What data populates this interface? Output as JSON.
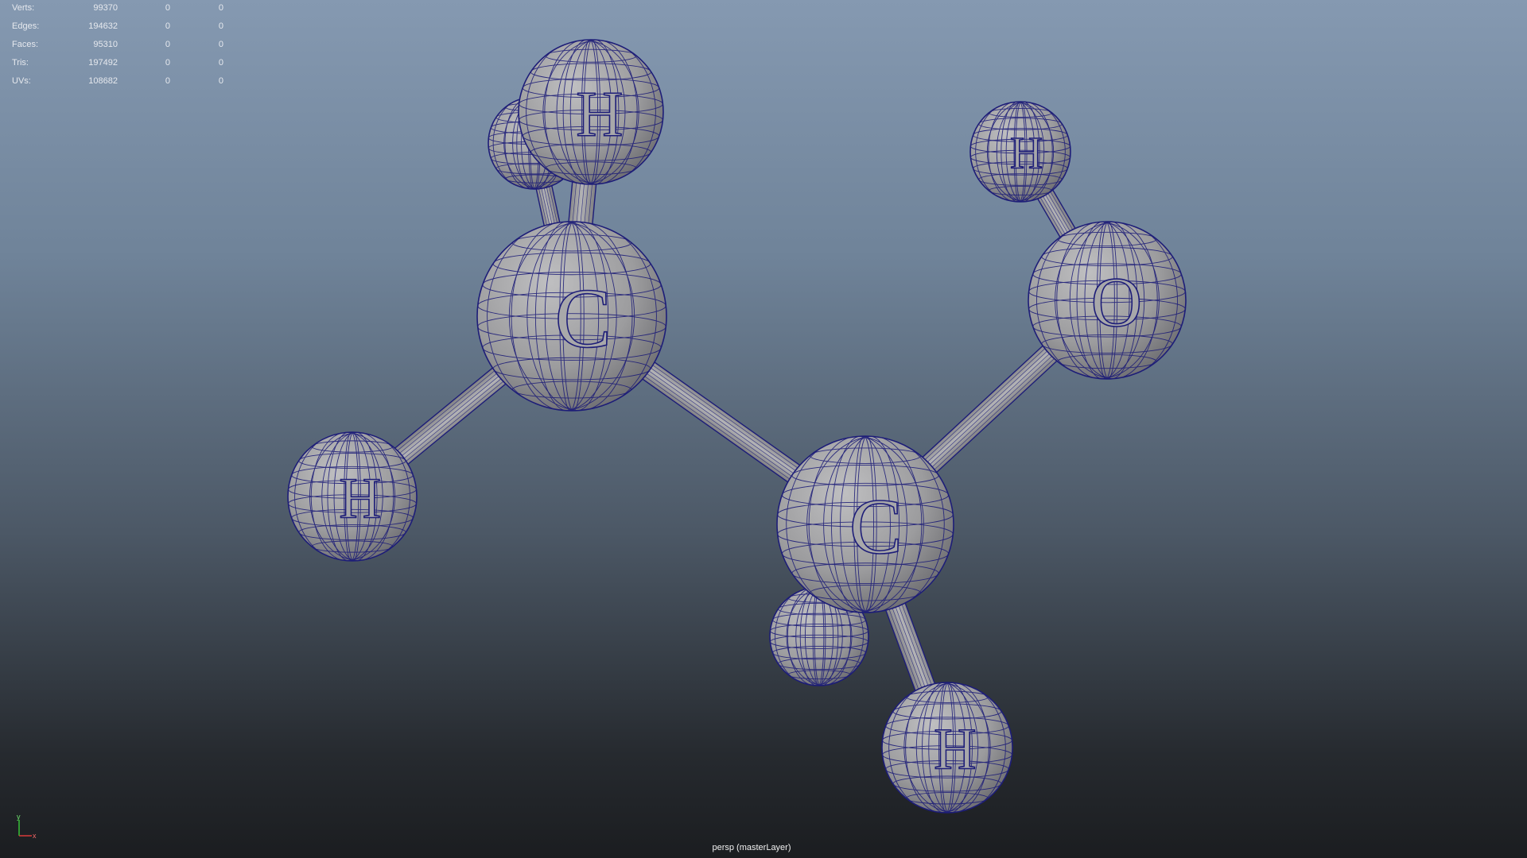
{
  "stats": [
    {
      "label": "Verts:",
      "values": [
        "99370",
        "0",
        "0"
      ]
    },
    {
      "label": "Edges:",
      "values": [
        "194632",
        "0",
        "0"
      ]
    },
    {
      "label": "Faces:",
      "values": [
        "95310",
        "0",
        "0"
      ]
    },
    {
      "label": "Tris:",
      "values": [
        "197492",
        "0",
        "0"
      ]
    },
    {
      "label": "UVs:",
      "values": [
        "108682",
        "0",
        "0"
      ]
    }
  ],
  "atoms": {
    "h_top_back": "",
    "h_top": "H",
    "c_left": "C",
    "h_left": "H",
    "h_right_top": "H",
    "o": "O",
    "c_right": "C",
    "h_bottom_back": "",
    "h_bottom": "H"
  },
  "camera_label": "persp (masterLayer)",
  "axis": {
    "y": "y",
    "x": "x"
  },
  "colors": {
    "wire": "#1d1d78",
    "atom_fill": "#9b9b9d",
    "bond_fill": "#a0a0a2",
    "label_text": "#e6e9ee"
  }
}
